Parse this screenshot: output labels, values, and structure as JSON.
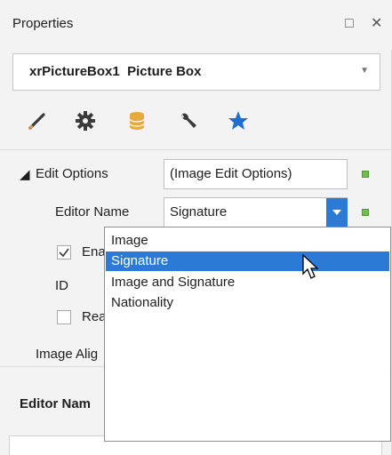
{
  "window": {
    "title": "Properties",
    "restore_glyph": "□",
    "close_glyph": "✕"
  },
  "object_selector": {
    "name": "xrPictureBox1",
    "type": "Picture Box"
  },
  "tabs": [
    {
      "icon": "brush-icon"
    },
    {
      "icon": "gear-icon"
    },
    {
      "icon": "database-icon"
    },
    {
      "icon": "wrench-icon"
    },
    {
      "icon": "star-icon"
    }
  ],
  "properties": {
    "edit_options_label": "Edit Options",
    "edit_options_value": "(Image Edit Options)",
    "editor_name_label": "Editor Name",
    "editor_name_value": "Signature",
    "enabled_label": "Ena",
    "id_label": "ID",
    "read_only_label": "Rea",
    "image_alignment_label": "Image Alig"
  },
  "dropdown": {
    "options": [
      "Image",
      "Signature",
      "Image and Signature",
      "Nationality"
    ],
    "selected": "Signature"
  },
  "description": {
    "title": "Editor Nam"
  },
  "colors": {
    "accent": "#2b7bd6",
    "green_marker": "#6fbf4a",
    "panel_bg": "#f3f3f3"
  }
}
